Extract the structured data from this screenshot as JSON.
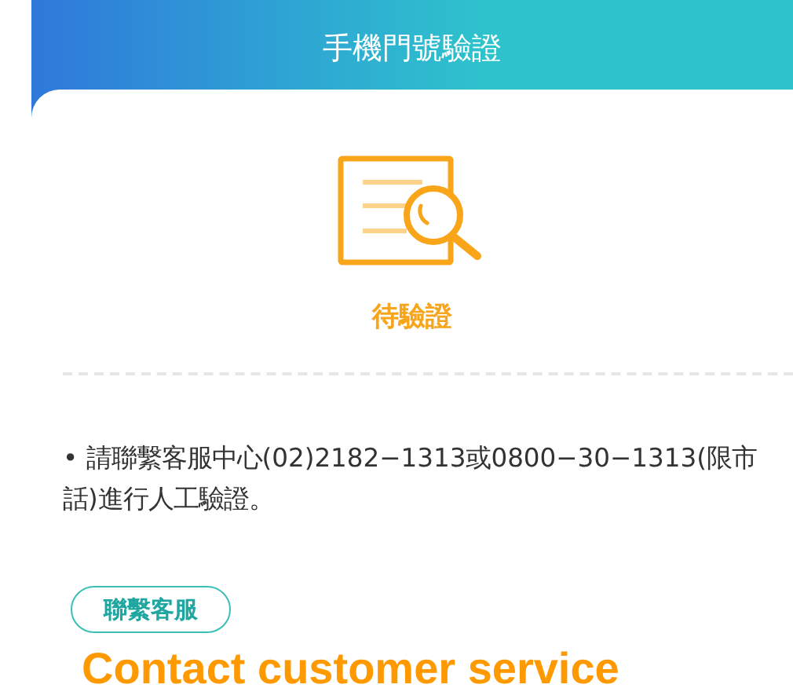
{
  "header": {
    "title": "手機門號驗證"
  },
  "status": {
    "label": "待驗證"
  },
  "notes": [
    "• 請聯繫客服中心(02)2182−1313或0800−30−1313(限市話)進行人工驗證。"
  ],
  "contact_button": {
    "label": "聯繫客服"
  },
  "caption": "Contact customer service"
}
